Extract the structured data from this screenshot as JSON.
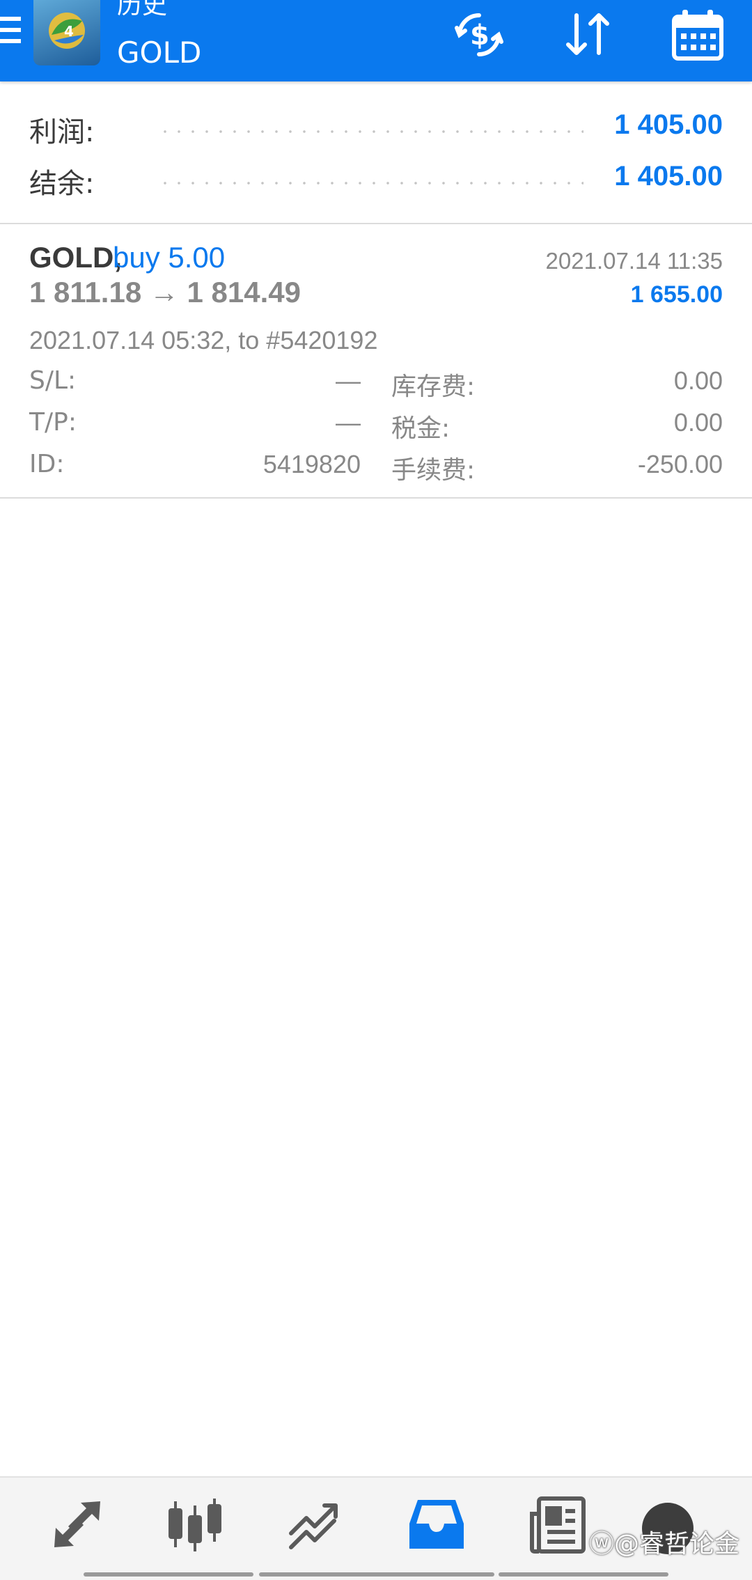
{
  "appbar": {
    "subtitle": "历史",
    "title": "GOLD",
    "icons": [
      "menu-icon",
      "metatrader-logo",
      "currency-exchange-icon",
      "sort-icon",
      "calendar-icon"
    ]
  },
  "summary": {
    "profit_label": "利润:",
    "profit_value": "1 405.00",
    "balance_label": "结余:",
    "balance_value": "1 405.00"
  },
  "trade": {
    "symbol": "GOLD,",
    "side": "buy 5.00",
    "close_time": "2021.07.14 11:35",
    "prices": "1 811.18 → 1 814.49",
    "profit": "1 655.00",
    "open_info": "2021.07.14 05:32, to #5420192",
    "details": {
      "sl_label": "S/L:",
      "sl_value": "—",
      "tp_label": "T/P:",
      "tp_value": "—",
      "id_label": "ID:",
      "id_value": "5419820",
      "swap_label": "库存费:",
      "swap_value": "0.00",
      "tax_label": "税金:",
      "tax_value": "0.00",
      "commission_label": "手续费:",
      "commission_value": "-250.00"
    }
  },
  "bottom_nav": {
    "items": [
      "trade-icon",
      "candlestick-icon",
      "chart-line-icon",
      "inbox-icon",
      "news-icon",
      "avatar"
    ],
    "active": "inbox-icon",
    "accent": "#0a79ee"
  },
  "watermark": "@睿哲论金"
}
